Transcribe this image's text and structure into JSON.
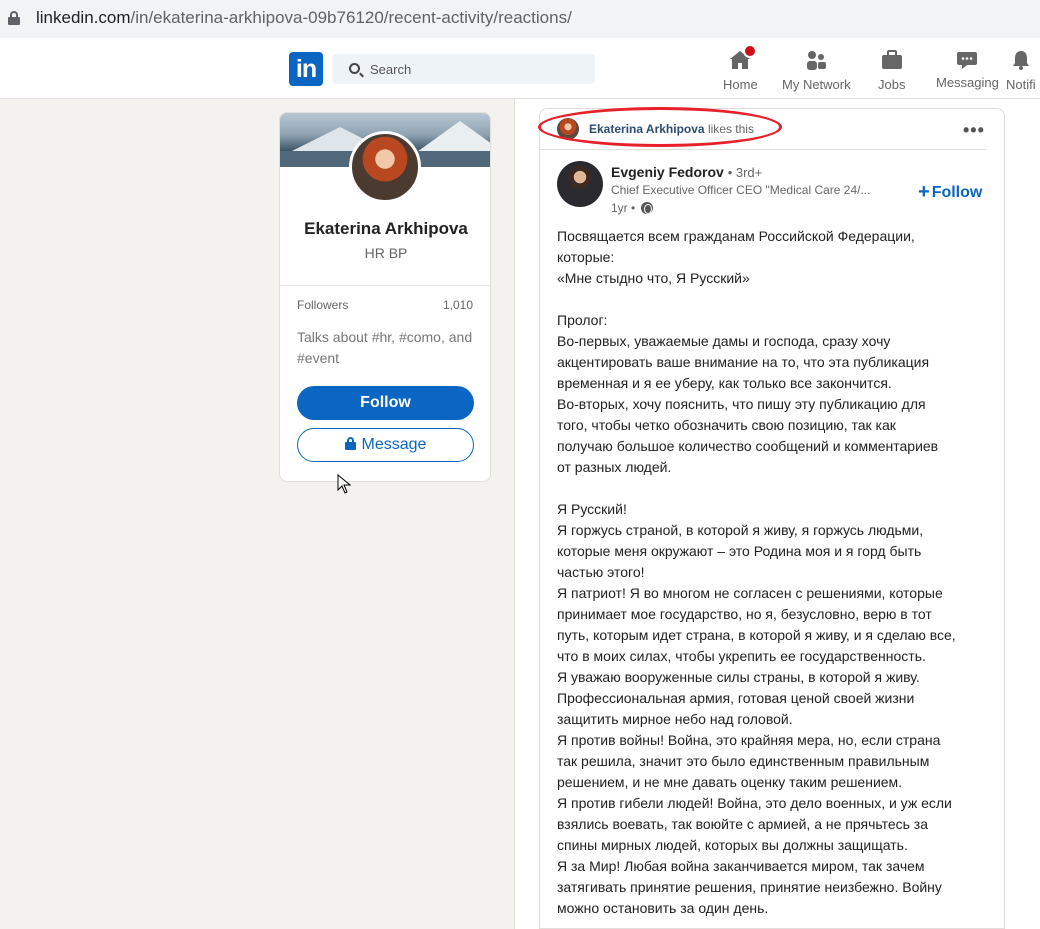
{
  "browser": {
    "url_domain": "linkedin.com",
    "url_path": "/in/ekaterina-arkhipova-09b76120/recent-activity/reactions/"
  },
  "nav": {
    "logo": "in",
    "search_placeholder": "Search",
    "items": [
      {
        "label": "Home",
        "icon": "home-icon",
        "badge": true
      },
      {
        "label": "My Network",
        "icon": "network-icon"
      },
      {
        "label": "Jobs",
        "icon": "briefcase-icon"
      },
      {
        "label": "Messaging",
        "icon": "messaging-icon"
      },
      {
        "label": "Notifi",
        "icon": "bell-icon"
      }
    ]
  },
  "profile": {
    "name": "Ekaterina Arkhipova",
    "title": "HR BP",
    "followers_label": "Followers",
    "followers_count": "1,010",
    "talks_about": "Talks about #hr, #como, and #event",
    "follow_label": "Follow",
    "message_label": "Message"
  },
  "activity": {
    "liker": "Ekaterina Arkhipova",
    "action": "likes this",
    "more": "•••",
    "author_name": "Evgeniy Fedorov",
    "author_degree": "• 3rd+",
    "author_headline": "Chief Executive Officer CEO \"Medical Care 24/...",
    "time": "1yr •",
    "follow_label": "Follow",
    "follow_plus": "+",
    "post_text": "Посвящается всем гражданам Российской Федерации,\nкоторые:\n«Мне стыдно что, Я Русский»\n\nПролог:\nВо-первых, уважаемые дамы и господа, сразу хочу\nакцентировать ваше внимание на то, что эта публикация\nвременная и я ее уберу, как только все закончится.\nВо-вторых, хочу пояснить, что пишу эту публикацию для\nтого, чтобы четко обозначить свою позицию, так как\nполучаю большое количество сообщений и комментариев\nот разных людей.\n\nЯ Русский!\nЯ горжусь страной, в которой я живу, я горжусь людьми,\nкоторые меня окружают – это Родина моя и я горд быть\nчастью этого!\nЯ патриот! Я во многом не согласен с решениями, которые\nпринимает мое государство, но я, безусловно, верю в тот\nпуть, которым идет страна, в которой я живу, и я сделаю все,\nчто в моих силах, чтобы укрепить ее государственность.\nЯ уважаю вооруженные силы страны, в которой я живу.\nПрофессиональная армия, готовая ценой своей жизни\nзащитить мирное небо над головой.\nЯ против войны! Война, это крайняя мера, но, если страна\nтак решила, значит это было единственным правильным\nрешением, и не мне давать оценку таким решением.\nЯ против гибели людей! Война, это дело военных, и уж если\nвзялись воевать, так воюйте с армией, а не прячьтесь за\nспины мирных людей, которых вы должны защищать.\nЯ за Мир! Любая война заканчивается миром, так зачем\nзатягивать принятие решения, принятие неизбежно. Войну\nможно остановить за один день."
  },
  "colors": {
    "brand": "#0a66c2",
    "highlight_oval": "#e8202a",
    "page_bg": "#f3f2ef"
  }
}
